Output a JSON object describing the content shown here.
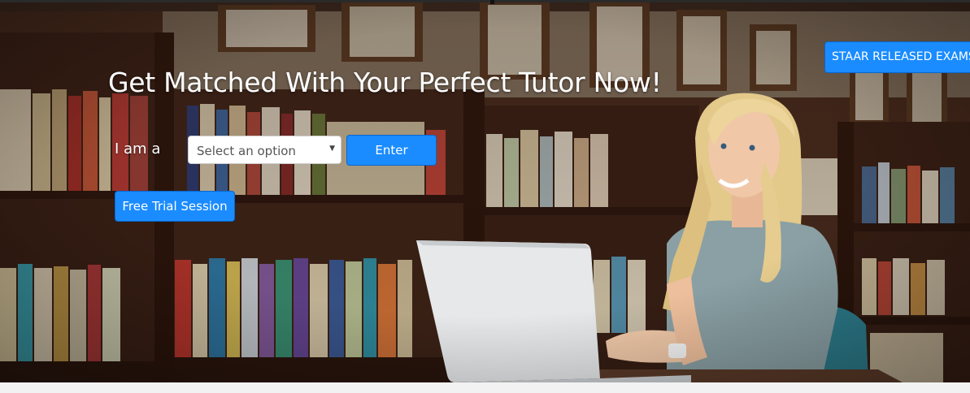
{
  "hero": {
    "title": "Get Matched With Your Perfect Tutor Now!",
    "iam_label": "I am a",
    "select": {
      "selected": "Select an option"
    },
    "enter_label": "Enter",
    "free_trial_label": "Free Trial Session",
    "staar_label": "STAAR RELEASED EXAMS"
  },
  "colors": {
    "accent": "#1a8cff",
    "page_bg": "#f2f2f2"
  }
}
